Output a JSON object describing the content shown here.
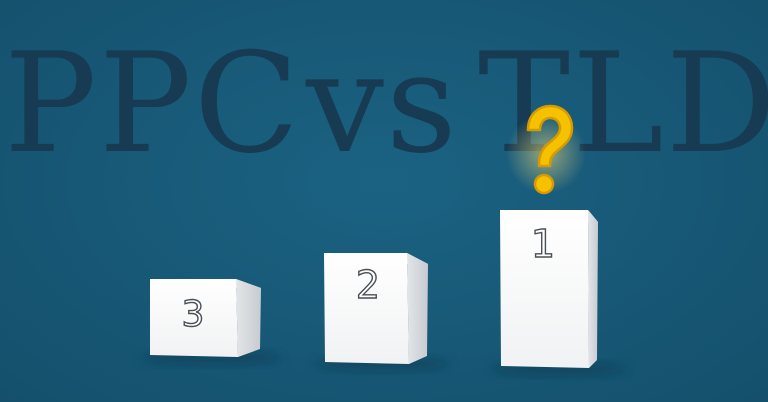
{
  "title": {
    "words": [
      "PPC",
      "vs",
      "TLD"
    ]
  },
  "podium": {
    "first_label": "1",
    "second_label": "2",
    "third_label": "3"
  },
  "colors": {
    "background": "#175876",
    "title_text": "#163b52",
    "question_mark": "#f6c200",
    "podium": "#ffffff"
  },
  "icons": {
    "question": "question-mark-icon"
  }
}
